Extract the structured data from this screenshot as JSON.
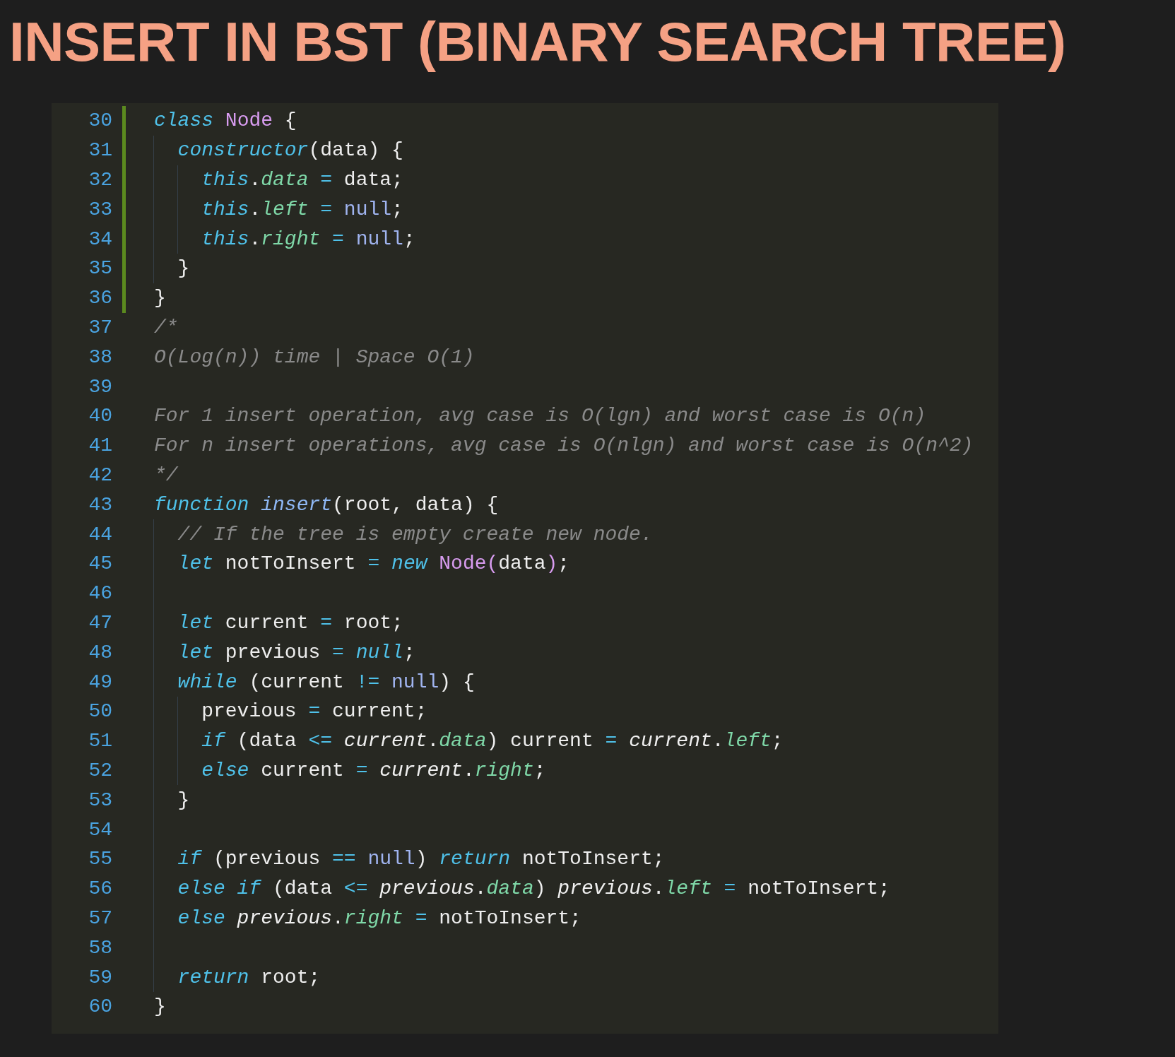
{
  "title": "INSERT IN BST (BINARY SEARCH TREE)",
  "editor": {
    "lines": [
      {
        "number": "30",
        "modified": true,
        "tokens": [
          {
            "text": "class ",
            "kind": "kw"
          },
          {
            "text": "Node",
            "kind": "cls"
          },
          {
            "text": " {",
            "kind": "txt"
          }
        ]
      },
      {
        "number": "31",
        "modified": true,
        "tokens": [
          {
            "kind": "ind"
          },
          {
            "text": "constructor",
            "kind": "kw"
          },
          {
            "text": "(data) {",
            "kind": "txt"
          }
        ]
      },
      {
        "number": "32",
        "modified": true,
        "tokens": [
          {
            "kind": "ind"
          },
          {
            "kind": "ind"
          },
          {
            "text": "this",
            "kind": "kw"
          },
          {
            "text": ".",
            "kind": "txt"
          },
          {
            "text": "data",
            "kind": "prop"
          },
          {
            "text": " = ",
            "kind": "op"
          },
          {
            "text": "data;",
            "kind": "txt"
          }
        ]
      },
      {
        "number": "33",
        "modified": true,
        "tokens": [
          {
            "kind": "ind"
          },
          {
            "kind": "ind"
          },
          {
            "text": "this",
            "kind": "kw"
          },
          {
            "text": ".",
            "kind": "txt"
          },
          {
            "text": "left",
            "kind": "prop"
          },
          {
            "text": " = ",
            "kind": "op"
          },
          {
            "text": "null",
            "kind": "nul"
          },
          {
            "text": ";",
            "kind": "txt"
          }
        ]
      },
      {
        "number": "34",
        "modified": true,
        "tokens": [
          {
            "kind": "ind"
          },
          {
            "kind": "ind"
          },
          {
            "text": "this",
            "kind": "kw"
          },
          {
            "text": ".",
            "kind": "txt"
          },
          {
            "text": "right",
            "kind": "prop"
          },
          {
            "text": " = ",
            "kind": "op"
          },
          {
            "text": "null",
            "kind": "nul"
          },
          {
            "text": ";",
            "kind": "txt"
          }
        ]
      },
      {
        "number": "35",
        "modified": true,
        "tokens": [
          {
            "kind": "ind"
          },
          {
            "text": "}",
            "kind": "txt"
          }
        ]
      },
      {
        "number": "36",
        "modified": true,
        "tokens": [
          {
            "text": "}",
            "kind": "txt"
          }
        ]
      },
      {
        "number": "37",
        "modified": false,
        "tokens": [
          {
            "text": "/*",
            "kind": "cmt"
          }
        ]
      },
      {
        "number": "38",
        "modified": false,
        "tokens": [
          {
            "text": "O(Log(n)) time | Space O(1)",
            "kind": "cmt"
          }
        ]
      },
      {
        "number": "39",
        "modified": false
      },
      {
        "number": "40",
        "modified": false,
        "tokens": [
          {
            "text": "For 1 insert operation, avg case is O(lgn) and worst case is O(n)",
            "kind": "cmt"
          }
        ]
      },
      {
        "number": "41",
        "modified": false,
        "tokens": [
          {
            "text": "For n insert operations, avg case is O(nlgn) and worst case is O(n^2)",
            "kind": "cmt"
          }
        ]
      },
      {
        "number": "42",
        "modified": false,
        "tokens": [
          {
            "text": "*/",
            "kind": "cmt"
          }
        ]
      },
      {
        "number": "43",
        "modified": false,
        "tokens": [
          {
            "text": "function ",
            "kind": "kw"
          },
          {
            "text": "insert",
            "kind": "fn"
          },
          {
            "text": "(root, data) {",
            "kind": "txt"
          }
        ]
      },
      {
        "number": "44",
        "modified": false,
        "tokens": [
          {
            "kind": "ind"
          },
          {
            "text": "// If the tree is empty create new node.",
            "kind": "cmt"
          }
        ]
      },
      {
        "number": "45",
        "modified": false,
        "tokens": [
          {
            "kind": "ind"
          },
          {
            "text": "let",
            "kind": "kw"
          },
          {
            "text": " notToInsert",
            "kind": "txt"
          },
          {
            "text": " = ",
            "kind": "op"
          },
          {
            "text": "new ",
            "kind": "kw"
          },
          {
            "text": "Node(",
            "kind": "cls"
          },
          {
            "text": "data",
            "kind": "txt"
          },
          {
            "text": ")",
            "kind": "cls"
          },
          {
            "text": ";",
            "kind": "txt"
          }
        ]
      },
      {
        "number": "46",
        "modified": false,
        "tokens": [
          {
            "kind": "ind"
          }
        ]
      },
      {
        "number": "47",
        "modified": false,
        "tokens": [
          {
            "kind": "ind"
          },
          {
            "text": "let",
            "kind": "kw"
          },
          {
            "text": " current",
            "kind": "txt"
          },
          {
            "text": " = ",
            "kind": "op"
          },
          {
            "text": "root;",
            "kind": "txt"
          }
        ]
      },
      {
        "number": "48",
        "modified": false,
        "tokens": [
          {
            "kind": "ind"
          },
          {
            "text": "let",
            "kind": "kw"
          },
          {
            "text": " previous",
            "kind": "txt"
          },
          {
            "text": " = ",
            "kind": "op"
          },
          {
            "text": "null",
            "kind": "kw"
          },
          {
            "text": ";",
            "kind": "txt"
          }
        ]
      },
      {
        "number": "49",
        "modified": false,
        "tokens": [
          {
            "kind": "ind"
          },
          {
            "text": "while",
            "kind": "kw"
          },
          {
            "text": " (current",
            "kind": "txt"
          },
          {
            "text": " != ",
            "kind": "op"
          },
          {
            "text": "null",
            "kind": "nul"
          },
          {
            "text": ") {",
            "kind": "txt"
          }
        ]
      },
      {
        "number": "50",
        "modified": false,
        "tokens": [
          {
            "kind": "ind"
          },
          {
            "kind": "ind"
          },
          {
            "text": "previous",
            "kind": "txt"
          },
          {
            "text": " = ",
            "kind": "op"
          },
          {
            "text": "current;",
            "kind": "txt"
          }
        ]
      },
      {
        "number": "51",
        "modified": false,
        "tokens": [
          {
            "kind": "ind"
          },
          {
            "kind": "ind"
          },
          {
            "text": "if",
            "kind": "kw"
          },
          {
            "text": " (data",
            "kind": "txt"
          },
          {
            "text": " <= ",
            "kind": "op"
          },
          {
            "text": "current",
            "kind": "var"
          },
          {
            "text": ".",
            "kind": "txt"
          },
          {
            "text": "data",
            "kind": "prop"
          },
          {
            "text": ") current",
            "kind": "txt"
          },
          {
            "text": " = ",
            "kind": "op"
          },
          {
            "text": "current",
            "kind": "var"
          },
          {
            "text": ".",
            "kind": "txt"
          },
          {
            "text": "left",
            "kind": "prop"
          },
          {
            "text": ";",
            "kind": "txt"
          }
        ]
      },
      {
        "number": "52",
        "modified": false,
        "tokens": [
          {
            "kind": "ind"
          },
          {
            "kind": "ind"
          },
          {
            "text": "else",
            "kind": "kw"
          },
          {
            "text": " current",
            "kind": "txt"
          },
          {
            "text": " = ",
            "kind": "op"
          },
          {
            "text": "current",
            "kind": "var"
          },
          {
            "text": ".",
            "kind": "txt"
          },
          {
            "text": "right",
            "kind": "prop"
          },
          {
            "text": ";",
            "kind": "txt"
          }
        ]
      },
      {
        "number": "53",
        "modified": false,
        "tokens": [
          {
            "kind": "ind"
          },
          {
            "text": "}",
            "kind": "txt"
          }
        ]
      },
      {
        "number": "54",
        "modified": false,
        "tokens": [
          {
            "kind": "ind"
          }
        ]
      },
      {
        "number": "55",
        "modified": false,
        "tokens": [
          {
            "kind": "ind"
          },
          {
            "text": "if",
            "kind": "kw"
          },
          {
            "text": " (previous",
            "kind": "txt"
          },
          {
            "text": " == ",
            "kind": "op"
          },
          {
            "text": "null",
            "kind": "nul"
          },
          {
            "text": ") ",
            "kind": "txt"
          },
          {
            "text": "return",
            "kind": "kw"
          },
          {
            "text": " notToInsert;",
            "kind": "txt"
          }
        ]
      },
      {
        "number": "56",
        "modified": false,
        "tokens": [
          {
            "kind": "ind"
          },
          {
            "text": "else if",
            "kind": "kw"
          },
          {
            "text": " (data",
            "kind": "txt"
          },
          {
            "text": " <= ",
            "kind": "op"
          },
          {
            "text": "previous",
            "kind": "var"
          },
          {
            "text": ".",
            "kind": "txt"
          },
          {
            "text": "data",
            "kind": "prop"
          },
          {
            "text": ") ",
            "kind": "txt"
          },
          {
            "text": "previous",
            "kind": "var"
          },
          {
            "text": ".",
            "kind": "txt"
          },
          {
            "text": "left",
            "kind": "prop"
          },
          {
            "text": " = ",
            "kind": "op"
          },
          {
            "text": "notToInsert;",
            "kind": "txt"
          }
        ]
      },
      {
        "number": "57",
        "modified": false,
        "tokens": [
          {
            "kind": "ind"
          },
          {
            "text": "else ",
            "kind": "kw"
          },
          {
            "text": "previous",
            "kind": "var"
          },
          {
            "text": ".",
            "kind": "txt"
          },
          {
            "text": "right",
            "kind": "prop"
          },
          {
            "text": " = ",
            "kind": "op"
          },
          {
            "text": "notToInsert;",
            "kind": "txt"
          }
        ]
      },
      {
        "number": "58",
        "modified": false,
        "tokens": [
          {
            "kind": "ind"
          }
        ]
      },
      {
        "number": "59",
        "modified": false,
        "tokens": [
          {
            "kind": "ind"
          },
          {
            "text": "return",
            "kind": "kw"
          },
          {
            "text": " root;",
            "kind": "txt"
          }
        ]
      },
      {
        "number": "60",
        "modified": false,
        "tokens": [
          {
            "text": "}",
            "kind": "txt"
          }
        ]
      }
    ]
  }
}
